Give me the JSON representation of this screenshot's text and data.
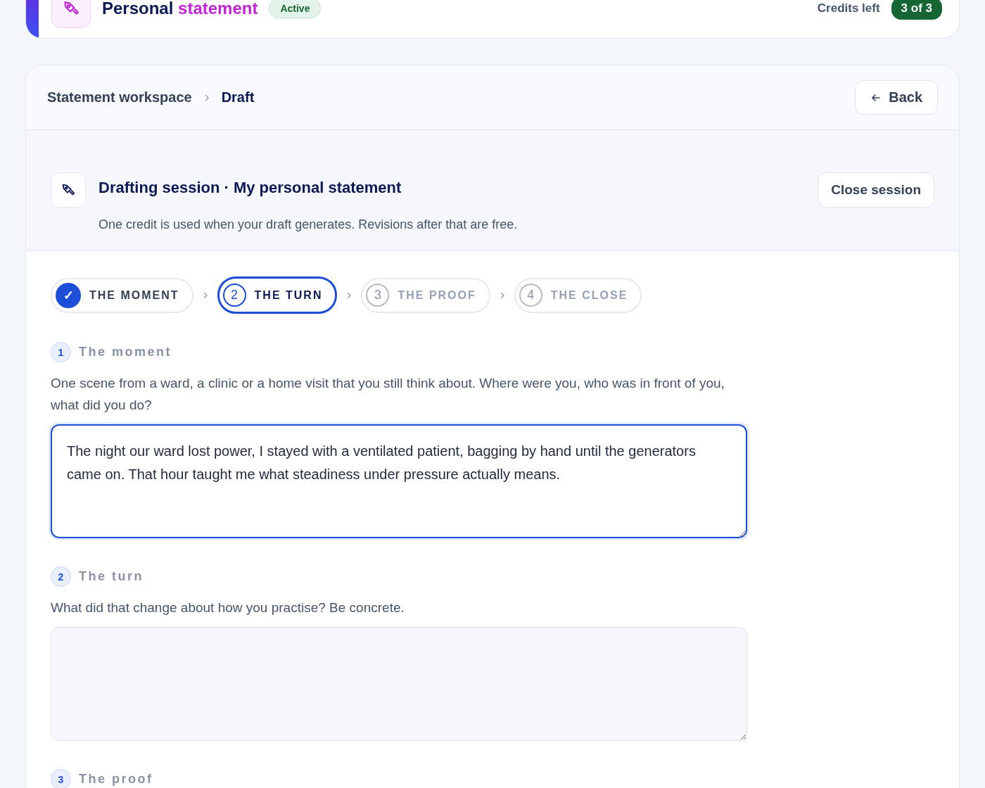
{
  "header": {
    "title": "Personal",
    "title_accent": "statement",
    "badge": "Active",
    "credits_label": "Credits left",
    "credits_value": "3 of 3"
  },
  "breadcrumb": {
    "items": [
      "Statement workspace",
      "Draft"
    ],
    "back": "Back"
  },
  "session": {
    "title": "Drafting session · My personal statement",
    "note": "One credit is used when your draft generates. Revisions after that are free.",
    "close": "Close session"
  },
  "steps": [
    {
      "number": "✓",
      "label": "THE MOMENT",
      "done": true,
      "selected": false
    },
    {
      "number": "2",
      "label": "THE TURN",
      "done": false,
      "selected": true
    },
    {
      "number": "3",
      "label": "THE PROOF",
      "done": false,
      "selected": false
    },
    {
      "number": "4",
      "label": "THE CLOSE",
      "done": false,
      "selected": false
    }
  ],
  "questions": [
    {
      "number": "1",
      "label": "The moment",
      "prompt": "One scene from a ward, a clinic or a home visit that you still think about. Where were you, who was in front of you, what did you do?",
      "field": {
        "value": "The night our ward lost power, I stayed with a ventilated patient, bagging by hand until the generators came on. That hour taught me what steadiness under pressure actually means.",
        "focused": true
      }
    },
    {
      "number": "2",
      "label": "The turn",
      "prompt": "What did that change about how you practise? Be concrete.",
      "field": {
        "focused": false
      }
    },
    {
      "number": "3",
      "label": "The proof"
    }
  ]
}
